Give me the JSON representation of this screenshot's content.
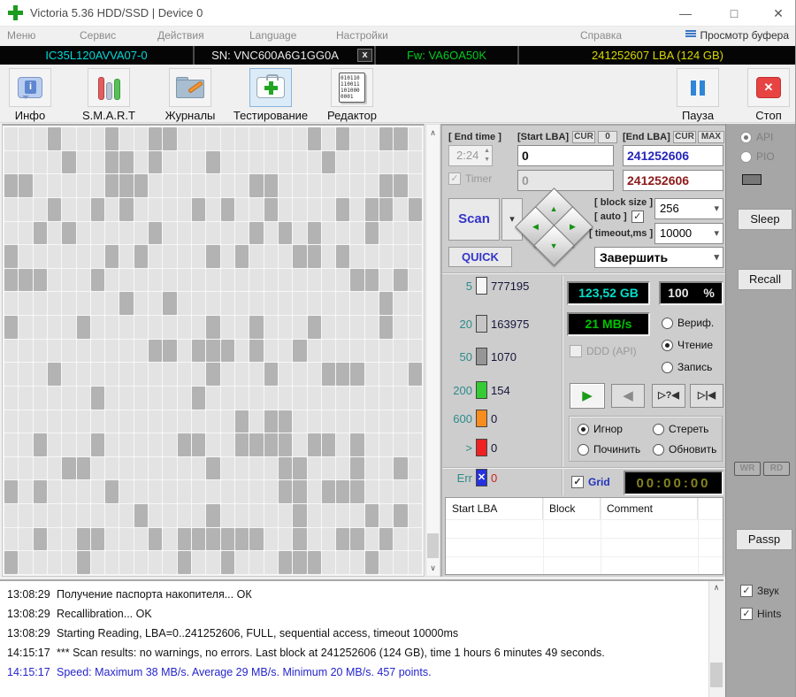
{
  "window": {
    "title": "Victoria 5.36 HDD/SSD | Device 0"
  },
  "icons": {
    "minimize": "—",
    "maximize": "□",
    "close": "✕",
    "check": "✓",
    "drop_arrow": "▾",
    "spin_up": "▲",
    "spin_down": "▼",
    "scroll_up": "∧",
    "scroll_down": "∨",
    "tri_up": "▲",
    "tri_left": "◀",
    "tri_right": "▶",
    "tri_down": "▼",
    "info_i": "i",
    "stop_x": "✕"
  },
  "menu": {
    "items": [
      "Меню",
      "Сервис",
      "Действия",
      "Language",
      "Настройки",
      "Справка"
    ],
    "buffer_view": "Просмотр буфера"
  },
  "device_bar": {
    "model": "IC35L120AVVA07-0",
    "serial": "SN: VNC600A6G1GG0A",
    "x_mark": "x",
    "firmware": "Fw: VA6OA50K",
    "capacity": "241252607 LBA (124 GB)"
  },
  "toolbar": {
    "info": "Инфо",
    "smart": "S.M.A.R.T",
    "journals": "Журналы",
    "testing": "Тестирование",
    "editor": "Редактор",
    "pause": "Пауза",
    "stop": "Стоп",
    "editor_binary": "010110\n110011\n101000\n0001"
  },
  "blockmap": {
    "cols": 29,
    "rows": 19,
    "dark_ratio": 0.27,
    "seed": 987654321,
    "light_color": "#e3e3e3",
    "dark_color": "#b3b3b3"
  },
  "controls": {
    "end_time_label": "[ End time ]",
    "end_time": "2:24",
    "timer_label": "Timer",
    "start_lba_label": "[Start LBA]",
    "cur_label": "CUR",
    "zero_label": "0",
    "start_lba_value": "0",
    "start_lba_value2": "0",
    "end_lba_label": "[End LBA]",
    "max_label": "MAX",
    "end_lba_value": "241252606",
    "end_lba_value2": "241252606",
    "scan_label": "Scan",
    "quick_label": "QUICK",
    "block_size_label": "[ block size ]",
    "auto_label": "[ auto ]",
    "block_size": "256",
    "timeout_label": "[ timeout,ms ]",
    "timeout": "10000",
    "finish_action": "Завершить"
  },
  "counters": [
    {
      "label": "5",
      "value": "777195",
      "color": "#f6f6f6",
      "mark": ""
    },
    {
      "label": "20",
      "value": "163975",
      "color": "#c6c6c6",
      "mark": ""
    },
    {
      "label": "50",
      "value": "1070",
      "color": "#969696",
      "mark": ""
    },
    {
      "label": "200",
      "value": "154",
      "color": "#35cb35",
      "mark": ""
    },
    {
      "label": "600",
      "value": "0",
      "color": "#f98c1e",
      "mark": ""
    },
    {
      "label": ">",
      "value": "0",
      "color": "#ee2222",
      "mark": ""
    },
    {
      "label": "Err",
      "value": "0",
      "color": "#2431dd",
      "mark": "✕"
    }
  ],
  "status": {
    "capacity": "123,52 GB",
    "capacity_color": "#00dfc8",
    "percent": "100",
    "percent_sign": "%",
    "percent_color": "#e8e8e8",
    "speed": "21 MB/s",
    "speed_color": "#00c400",
    "ddd_label": "DDD (API)",
    "modes": [
      "Вериф.",
      "Чтение",
      "Запись"
    ],
    "playback": {
      "play": "▶",
      "back": "◀",
      "find": "▷?◀",
      "edge": "▷|◀"
    },
    "actions": [
      "Игнор",
      "Стереть",
      "Починить",
      "Обновить"
    ],
    "grid_label": "Grid",
    "timer_display": "00:00:00",
    "timer_color": "#83831e"
  },
  "defect_table": {
    "headers": [
      "Start LBA",
      "Block",
      "Comment"
    ]
  },
  "right_column": {
    "api": "API",
    "pio": "PIO",
    "sleep": "Sleep",
    "recall": "Recall",
    "wr": "WR",
    "rd": "RD",
    "passp": "Passp",
    "sound": "Звук",
    "hints": "Hints"
  },
  "log": {
    "entries": [
      {
        "time": "13:08:29",
        "message": "Получение паспорта накопителя... ОК"
      },
      {
        "time": "13:08:29",
        "message": "Recallibration... OK"
      },
      {
        "time": "13:08:29",
        "message": "Starting Reading, LBA=0..241252606, FULL, sequential access, timeout 10000ms"
      },
      {
        "time": "14:15:17",
        "message": "*** Scan results: no warnings, no errors. Last block at 241252606 (124 GB), time 1 hours 6 minutes 49 seconds."
      },
      {
        "time": "14:15:17",
        "message": "Speed: Maximum 38 MB/s. Average 29 MB/s. Minimum 20 MB/s. 457 points."
      }
    ]
  }
}
